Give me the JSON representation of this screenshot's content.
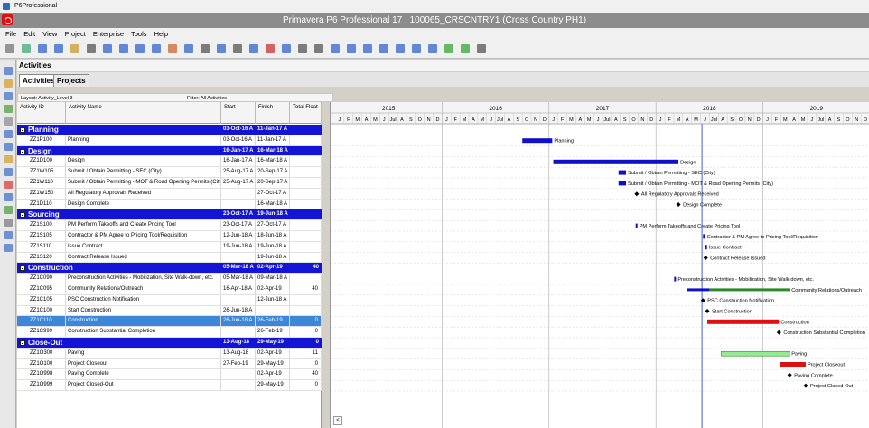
{
  "app": {
    "title": "P6Professional",
    "window_title": "Primavera P6 Professional 17 : 100065_CRSCNTRY1 (Cross Country PH1)"
  },
  "menu": [
    "File",
    "Edit",
    "View",
    "Project",
    "Enterprise",
    "Tools",
    "Help"
  ],
  "panel": {
    "title": "Activities",
    "tabs": [
      "Activities",
      "Projects"
    ]
  },
  "layout": {
    "label": "Layout: Activity_Level 3",
    "filter": "Filter: All Activities"
  },
  "columns": [
    "Activity ID",
    "Activity Name",
    "Start",
    "Finish",
    "Total Float"
  ],
  "years": [
    "2015",
    "2016",
    "2017",
    "2018",
    "2019"
  ],
  "months": [
    "J",
    "F",
    "M",
    "A",
    "M",
    "J",
    "Jul",
    "A",
    "S",
    "O",
    "N",
    "D"
  ],
  "rows": [
    {
      "type": "wbs",
      "name": "Planning",
      "start": "03-Oct-16 A",
      "finish": "11-Jan-17 A",
      "tf": ""
    },
    {
      "type": "act",
      "id": "ZZ1P100",
      "name": "Planning",
      "start": "03-Oct-16 A",
      "finish": "11-Jan-17 A",
      "tf": "",
      "bar": {
        "kind": "bar",
        "s": 2016.75,
        "e": 2017.03,
        "c": "#1010c8"
      },
      "label": "Planning"
    },
    {
      "type": "wbs",
      "name": "Design",
      "start": "16-Jan-17 A",
      "finish": "16-Mar-18 A",
      "tf": ""
    },
    {
      "type": "act",
      "id": "ZZ1D100",
      "name": "Design",
      "start": "16-Jan-17 A",
      "finish": "16-Mar-18 A",
      "tf": "",
      "bar": {
        "kind": "bar",
        "s": 2017.04,
        "e": 2018.21,
        "c": "#1010c8"
      },
      "label": "Design"
    },
    {
      "type": "act",
      "id": "ZZ1W105",
      "name": "Submit / Obtain Permitting - SEC (City)",
      "start": "25-Aug-17 A",
      "finish": "20-Sep-17 A",
      "tf": "",
      "bar": {
        "kind": "bar",
        "s": 2017.65,
        "e": 2017.72,
        "c": "#1010c8"
      },
      "label": "Submit / Obtain Permitting - SEC (City)"
    },
    {
      "type": "act",
      "id": "ZZ1W110",
      "name": "Submit / Obtain Permitting - MOT & Road Opening Permits (City)",
      "start": "25-Aug-17 A",
      "finish": "20-Sep-17 A",
      "tf": "",
      "bar": {
        "kind": "bar",
        "s": 2017.65,
        "e": 2017.72,
        "c": "#1010c8"
      },
      "label": "Submit / Obtain Permitting - MOT & Road Opening Permits (City)"
    },
    {
      "type": "act",
      "id": "ZZ1W150",
      "name": "All Regulatory Approvals Received",
      "start": "",
      "finish": "27-Oct-17 A",
      "tf": "",
      "bar": {
        "kind": "ms",
        "s": 2017.82
      },
      "label": "All Regulatory Approvals Received"
    },
    {
      "type": "act",
      "id": "ZZ1D110",
      "name": "Design Complete",
      "start": "",
      "finish": "16-Mar-18 A",
      "tf": "",
      "bar": {
        "kind": "ms",
        "s": 2018.21
      },
      "label": "Design Complete"
    },
    {
      "type": "wbs",
      "name": "Sourcing",
      "start": "23-Oct-17 A",
      "finish": "19-Jun-18 A",
      "tf": ""
    },
    {
      "type": "act",
      "id": "ZZ1S100",
      "name": "PM Perform Takeoffs and Create Pricing Tool",
      "start": "23-Oct-17 A",
      "finish": "27-Oct-17 A",
      "tf": "",
      "bar": {
        "kind": "bar",
        "s": 2017.81,
        "e": 2017.825,
        "c": "#1010c8"
      },
      "label": "PM Perform Takeoffs and Create Pricing Tool"
    },
    {
      "type": "act",
      "id": "ZZ1S105",
      "name": "Contractor & PM Agree to Pricing Tool/Requisition",
      "start": "12-Jun-18 A",
      "finish": "18-Jun-18 A",
      "tf": "",
      "bar": {
        "kind": "bar",
        "s": 2018.44,
        "e": 2018.46,
        "c": "#1010c8"
      },
      "label": "Contractor & PM Agree to Pricing Tool/Requisition"
    },
    {
      "type": "act",
      "id": "ZZ1S110",
      "name": "Issue Contract",
      "start": "19-Jun-18 A",
      "finish": "19-Jun-18 A",
      "tf": "",
      "bar": {
        "kind": "bar",
        "s": 2018.46,
        "e": 2018.465,
        "c": "#1010c8"
      },
      "label": "Issue Contract"
    },
    {
      "type": "act",
      "id": "ZZ1S120",
      "name": "Contract Release Issued",
      "start": "",
      "finish": "19-Jun-18 A",
      "tf": "",
      "bar": {
        "kind": "ms",
        "s": 2018.465
      },
      "label": "Contract Release Issued"
    },
    {
      "type": "wbs",
      "name": "Construction",
      "start": "05-Mar-18 A",
      "finish": "02-Apr-19",
      "tf": "40"
    },
    {
      "type": "act",
      "id": "ZZ1C090",
      "name": "Preconstruction Activities - Mobilization, Site Walk-down, etc.",
      "start": "05-Mar-18 A",
      "finish": "09-Mar-18 A",
      "tf": "",
      "bar": {
        "kind": "bar",
        "s": 2018.17,
        "e": 2018.185,
        "c": "#1010c8"
      },
      "label": "Preconstruction Activities - Mobilization, Site Walk-down, etc."
    },
    {
      "type": "act",
      "id": "ZZ1C095",
      "name": "Community Relations/Outreach",
      "start": "16-Apr-18 A",
      "finish": "02-Apr-19",
      "tf": "40",
      "bar": {
        "kind": "split",
        "s": 2018.29,
        "m": 2018.5,
        "e": 2019.25
      },
      "label": "Community Relations/Outreach"
    },
    {
      "type": "act",
      "id": "ZZ1C105",
      "name": "PSC Construction Notification",
      "start": "",
      "finish": "12-Jun-18 A",
      "tf": "",
      "bar": {
        "kind": "ms",
        "s": 2018.44
      },
      "label": "PSC Construction Notification"
    },
    {
      "type": "act",
      "id": "ZZ1C100",
      "name": "Start Construction",
      "start": "26-Jun-18 A",
      "finish": "",
      "tf": "",
      "bar": {
        "kind": "ms",
        "s": 2018.48
      },
      "label": "Start Construction"
    },
    {
      "type": "act",
      "id": "ZZ1C110",
      "name": "Construction",
      "start": "26-Jun-18 A",
      "finish": "26-Feb-19",
      "tf": "0",
      "sel": true,
      "bar": {
        "kind": "bar",
        "s": 2018.48,
        "e": 2019.15,
        "c": "#e01010"
      },
      "label": "Construction"
    },
    {
      "type": "act",
      "id": "ZZ1C999",
      "name": "Construction Substantial Completion",
      "start": "",
      "finish": "26-Feb-19",
      "tf": "0",
      "bar": {
        "kind": "ms",
        "s": 2019.15
      },
      "label": "Construction Substantial Completion"
    },
    {
      "type": "wbs",
      "name": "Close-Out",
      "start": "13-Aug-18",
      "finish": "29-May-19",
      "tf": "0"
    },
    {
      "type": "act",
      "id": "ZZ1O300",
      "name": "Paving",
      "start": "13-Aug-18",
      "finish": "02-Apr-19",
      "tf": "11",
      "bar": {
        "kind": "bar",
        "s": 2018.61,
        "e": 2019.25,
        "c": "#90ee90"
      },
      "label": "Paving"
    },
    {
      "type": "act",
      "id": "ZZ1O100",
      "name": "Project Closeout",
      "start": "27-Feb-19",
      "finish": "29-May-19",
      "tf": "0",
      "bar": {
        "kind": "bar",
        "s": 2019.16,
        "e": 2019.4,
        "c": "#e01010"
      },
      "label": "Project Closeout"
    },
    {
      "type": "act",
      "id": "ZZ1O998",
      "name": "Paving Complete",
      "start": "",
      "finish": "02-Apr-19",
      "tf": "40",
      "bar": {
        "kind": "ms",
        "s": 2019.25
      },
      "label": "Paving Complete"
    },
    {
      "type": "act",
      "id": "ZZ1O999",
      "name": "Project Closed-Out",
      "start": "",
      "finish": "29-May-19",
      "tf": "0",
      "bar": {
        "kind": "ms",
        "s": 2019.4
      },
      "label": "Project Closed-Out"
    }
  ],
  "data_date": 2018.43,
  "timeline_start": 2015.0,
  "timeline_end": 2020.0
}
